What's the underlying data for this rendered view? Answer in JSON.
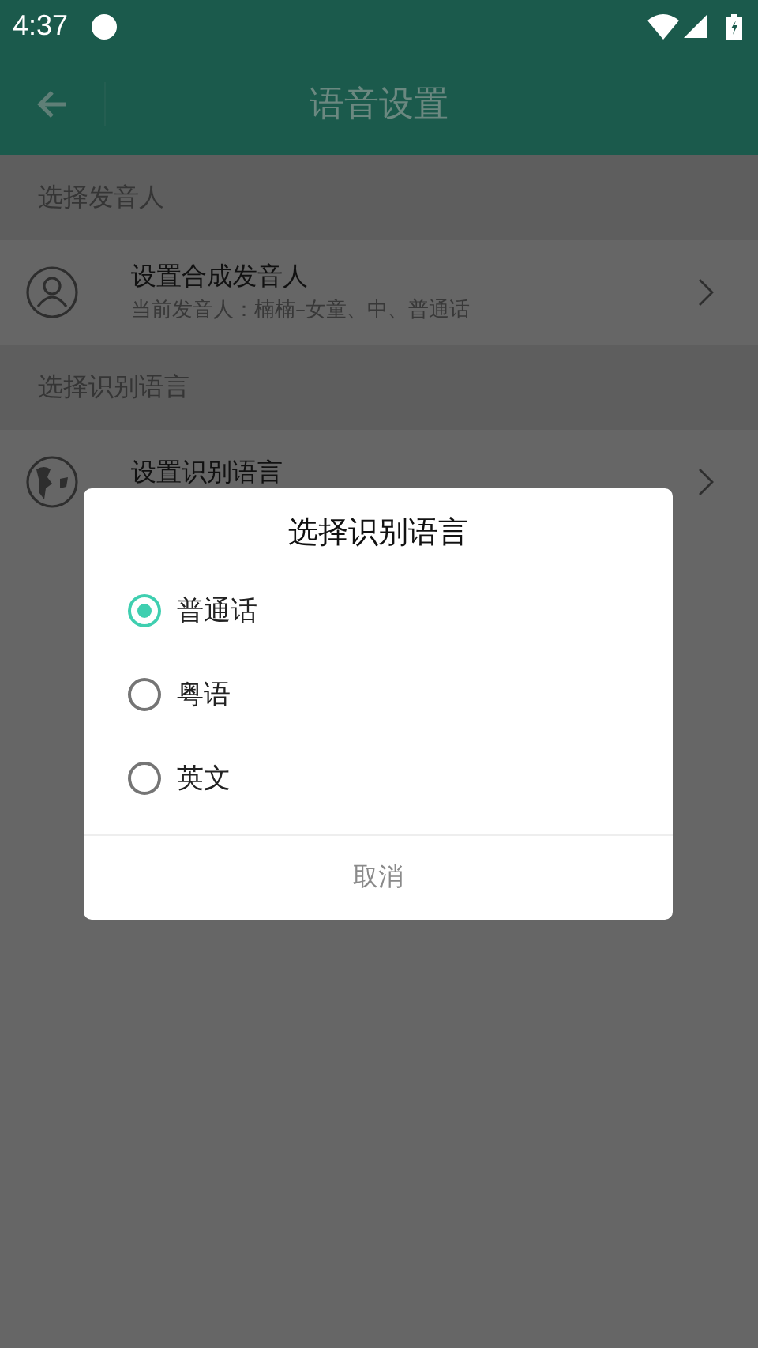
{
  "status_bar": {
    "time": "4:37"
  },
  "toolbar": {
    "title": "语音设置"
  },
  "sections": [
    {
      "header": "选择发音人",
      "item": {
        "kind": "person",
        "title": "设置合成发音人",
        "subtitle": "当前发音人：楠楠–女童、中、普通话"
      }
    },
    {
      "header": "选择识别语言",
      "item": {
        "kind": "globe",
        "title": "设置识别语言"
      }
    }
  ],
  "dialog": {
    "title": "选择识别语言",
    "options": [
      {
        "label": "普通话",
        "selected": true
      },
      {
        "label": "粤语",
        "selected": false
      },
      {
        "label": "英文",
        "selected": false
      }
    ],
    "cancel": "取消"
  }
}
